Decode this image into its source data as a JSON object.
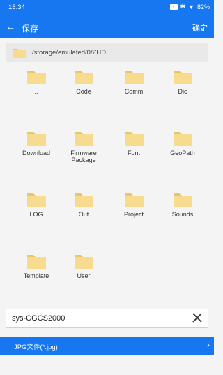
{
  "status_bar": {
    "time": "15:34",
    "battery": "82%"
  },
  "header": {
    "back_icon": "arrow-left-icon",
    "title": "保存",
    "confirm_label": "确定"
  },
  "path": {
    "text": "/storage/emulated/0/ZHD"
  },
  "folders": [
    {
      "label": ".."
    },
    {
      "label": "Code"
    },
    {
      "label": "Comm"
    },
    {
      "label": "Dic"
    },
    {
      "label": "Download"
    },
    {
      "label": "Firmware\nPackage"
    },
    {
      "label": "Font"
    },
    {
      "label": "GeoPath"
    },
    {
      "label": "LOG"
    },
    {
      "label": "Out"
    },
    {
      "label": "Project"
    },
    {
      "label": "Sounds"
    },
    {
      "label": "Template"
    },
    {
      "label": "User"
    }
  ],
  "filename": {
    "value": "sys-CGCS2000"
  },
  "file_type": {
    "label": "JPG文件(*.jpg)"
  },
  "colors": {
    "accent": "#1677f0",
    "folder_fill": "#f7dc8f",
    "folder_tab": "#e9c666"
  }
}
